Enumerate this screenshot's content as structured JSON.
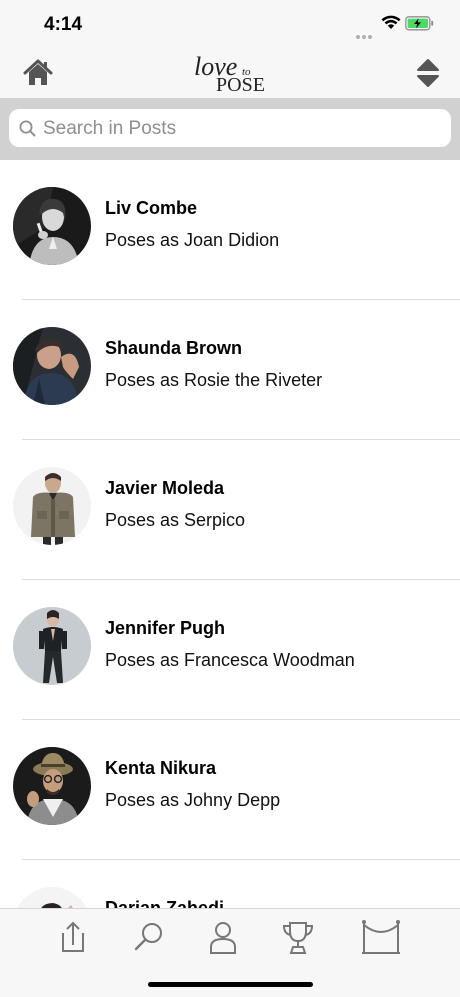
{
  "status_bar": {
    "time": "4:14"
  },
  "header": {
    "logo_line1": "love",
    "logo_line2": "to",
    "logo_line3": "POSE",
    "home_icon": "home-icon",
    "sort_icon": "sort-up-down-icon"
  },
  "search": {
    "placeholder": "Search in Posts",
    "value": ""
  },
  "posts": [
    {
      "name": "Liv Combe",
      "subtitle": "Poses as Joan Didion"
    },
    {
      "name": "Shaunda Brown",
      "subtitle": "Poses as Rosie the Riveter"
    },
    {
      "name": "Javier Moleda",
      "subtitle": "Poses as Serpico"
    },
    {
      "name": "Jennifer Pugh",
      "subtitle": "Poses as Francesca Woodman"
    },
    {
      "name": "Kenta Nikura",
      "subtitle": "Poses as Johny Depp"
    },
    {
      "name": "Darian Zahedi",
      "subtitle": ""
    }
  ],
  "tabbar": {
    "tabs": [
      "share-icon",
      "search-icon",
      "profile-icon",
      "trophy-icon",
      "gallery-icon"
    ]
  },
  "colors": {
    "bar_background": "#f7f7f7",
    "search_band": "#d1d1d1",
    "battery_green": "#4cd964"
  }
}
